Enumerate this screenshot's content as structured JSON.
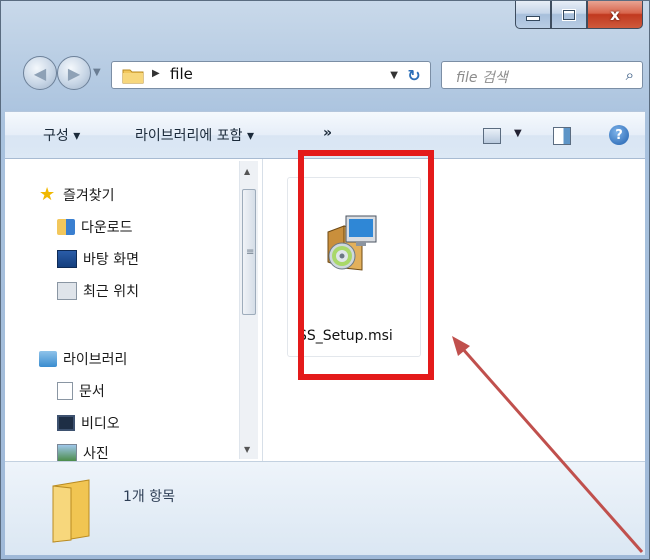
{
  "window": {
    "caption": {
      "minimize_glyph": "–",
      "maximize_glyph": "□",
      "close_glyph": "x"
    }
  },
  "address": {
    "path": "file",
    "search_placeholder": "file 검색"
  },
  "toolbar": {
    "organize": "구성 ▾",
    "include_in_library": "라이브러리에 포함 ▾",
    "more": "»"
  },
  "nav": {
    "favorites": {
      "label": "즐겨찾기",
      "items": [
        "다운로드",
        "바탕 화면",
        "최근 위치"
      ]
    },
    "libraries": {
      "label": "라이브러리",
      "items": [
        "문서",
        "비디오",
        "사진"
      ]
    }
  },
  "content": {
    "file": {
      "name": "SS_Setup.msi",
      "icon": "msi-installer-icon"
    }
  },
  "status": {
    "item_count": "1개 항목"
  },
  "colors": {
    "highlight": "#e41a1a",
    "arrow": "#c0504d"
  }
}
